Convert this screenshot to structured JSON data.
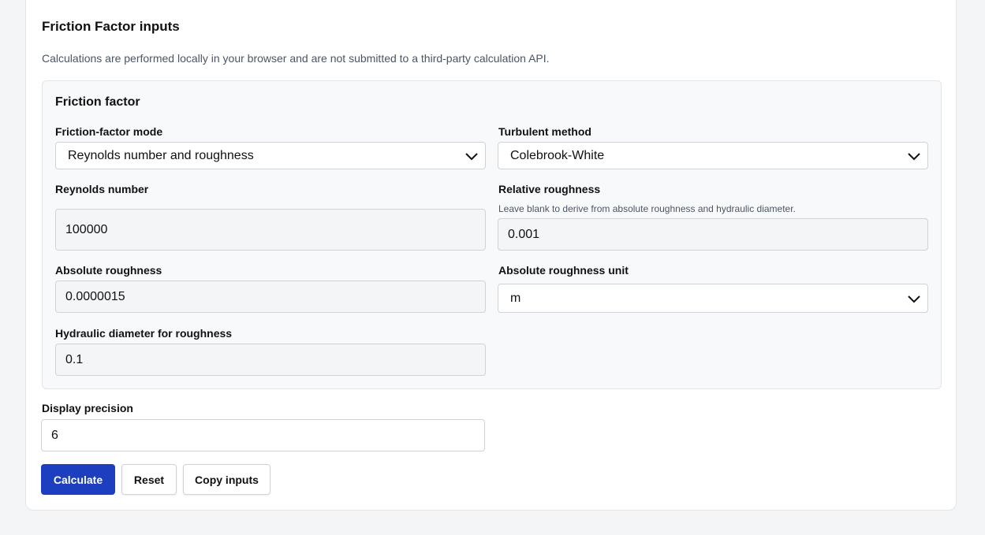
{
  "form": {
    "title": "Friction Factor inputs",
    "subtitle": "Calculations are performed locally in your browser and are not submitted to a third-party calculation API."
  },
  "section": {
    "title": "Friction factor",
    "mode": {
      "label": "Friction-factor mode",
      "value": "Reynolds number and roughness"
    },
    "method": {
      "label": "Turbulent method",
      "value": "Colebrook-White"
    },
    "reynolds": {
      "label": "Reynolds number",
      "value": "100000"
    },
    "relative_roughness": {
      "label": "Relative roughness",
      "help": "Leave blank to derive from absolute roughness and hydraulic diameter.",
      "value": "0.001"
    },
    "absolute_roughness": {
      "label": "Absolute roughness",
      "value": "0.0000015"
    },
    "roughness_unit": {
      "label": "Absolute roughness unit",
      "value": "m"
    },
    "hydraulic_diameter": {
      "label": "Hydraulic diameter for roughness",
      "value": "0.1"
    }
  },
  "precision": {
    "label": "Display precision",
    "value": "6"
  },
  "buttons": {
    "calculate": "Calculate",
    "reset": "Reset",
    "copy": "Copy inputs"
  },
  "colors": {
    "primary": "#1d3fbf",
    "background": "#f4f5f7"
  },
  "icons": {
    "dropdown": "chevron-down-icon"
  }
}
